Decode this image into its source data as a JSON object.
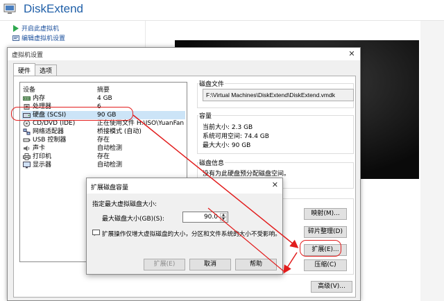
{
  "app": {
    "title": "DiskExtend",
    "actions": [
      {
        "label": "开启此虚拟机"
      },
      {
        "label": "编辑虚拟机设置"
      }
    ]
  },
  "settings_dialog": {
    "title": "虚拟机设置",
    "tabs": [
      {
        "label": "硬件"
      },
      {
        "label": "选项"
      }
    ],
    "device_headers": {
      "device": "设备",
      "summary": "摘要"
    },
    "devices": [
      {
        "name": "内存",
        "summary": "4 GB",
        "icon": "memory-icon"
      },
      {
        "name": "处理器",
        "summary": "6",
        "icon": "cpu-icon"
      },
      {
        "name": "硬盘 (SCSI)",
        "summary": "90 GB",
        "icon": "harddisk-icon"
      },
      {
        "name": "CD/DVD (IDE)",
        "summary": "正在使用文件 H:\\ISO\\YuanFan...",
        "icon": "cdrom-icon"
      },
      {
        "name": "网络适配器",
        "summary": "桥接模式 (自动)",
        "icon": "network-icon"
      },
      {
        "name": "USB 控制器",
        "summary": "存在",
        "icon": "usb-icon"
      },
      {
        "name": "声卡",
        "summary": "自动检测",
        "icon": "sound-icon"
      },
      {
        "name": "打印机",
        "summary": "存在",
        "icon": "printer-icon"
      },
      {
        "name": "显示器",
        "summary": "自动检测",
        "icon": "monitor-icon"
      }
    ],
    "disk_file": {
      "label": "磁盘文件",
      "path": "F:\\Virtual Machines\\DiskExtend\\DiskExtend.vmdk"
    },
    "capacity": {
      "label": "容量",
      "current_size": "当前大小: 2.3 GB",
      "system_free": "系统可用空间: 74.4 GB",
      "max_size": "最大大小: 90 GB"
    },
    "disk_info": {
      "label": "磁盘信息",
      "text": "没有为此硬盘预分配磁盘空间。"
    },
    "buttons": {
      "map": "映射(M)...",
      "defrag": "碎片整理(D)",
      "expand": "扩展(E)...",
      "compact": "压缩(C)",
      "advanced": "高级(V)..."
    }
  },
  "expand_dialog": {
    "title": "扩展磁盘容量",
    "prompt": "指定最大虚拟磁盘大小:",
    "size_label": "最大磁盘大小(GB)(S):",
    "size_value": "90.0",
    "note": "扩展操作仅增大虚拟磁盘的大小，分区和文件系统的大小不受影响。",
    "buttons": {
      "expand": "扩展(E)",
      "cancel": "取消",
      "help": "帮助"
    }
  },
  "colors": {
    "title_blue": "#1f5fa8",
    "selection": "#cce4f7",
    "annotation_red": "#e21c1c"
  }
}
